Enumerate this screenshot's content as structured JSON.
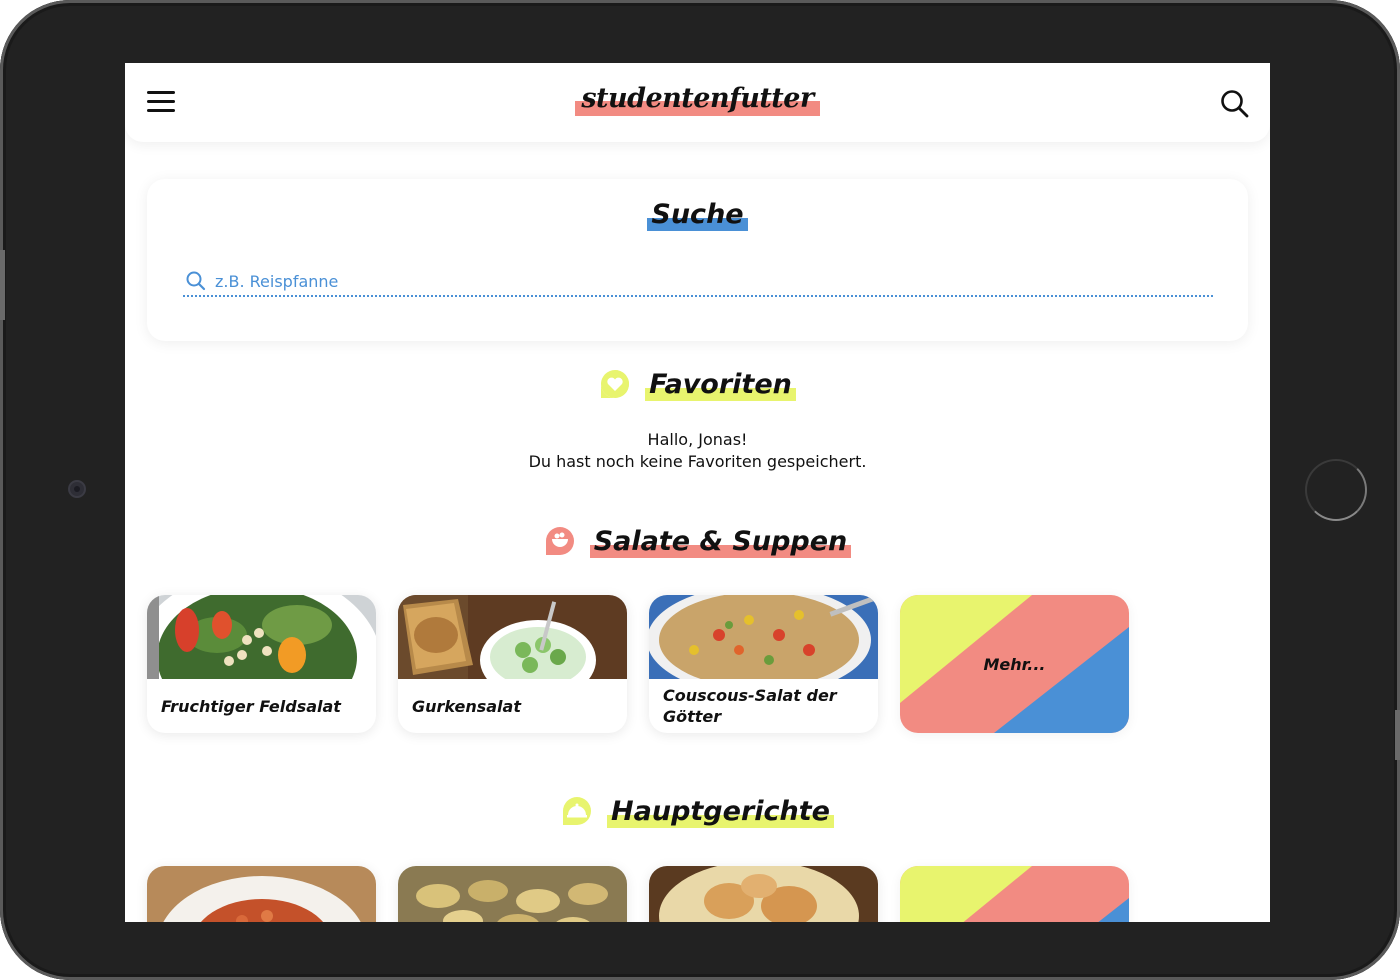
{
  "app": {
    "brand": "studentenfutter"
  },
  "colors": {
    "accent_red": "#f28b82",
    "accent_blue": "#4a90d6",
    "accent_yellow": "#e8f46e"
  },
  "header": {
    "menu_icon": "hamburger-menu-icon",
    "search_icon": "search-icon"
  },
  "search": {
    "title": "Suche",
    "placeholder": "z.B. Reispfanne",
    "value": ""
  },
  "favorites": {
    "title": "Favoriten",
    "icon": "heart-icon",
    "greeting": "Hallo, Jonas!",
    "message": "Du hast noch keine Favoriten gespeichert."
  },
  "salads": {
    "title": "Salate & Suppen",
    "icon": "bowl-icon",
    "cards": [
      {
        "label": "Fruchtiger Feldsalat"
      },
      {
        "label": "Gurkensalat"
      },
      {
        "label": "Couscous-Salat der Götter"
      }
    ],
    "more_label": "Mehr..."
  },
  "mains": {
    "title": "Hauptgerichte",
    "icon": "cloche-icon"
  }
}
